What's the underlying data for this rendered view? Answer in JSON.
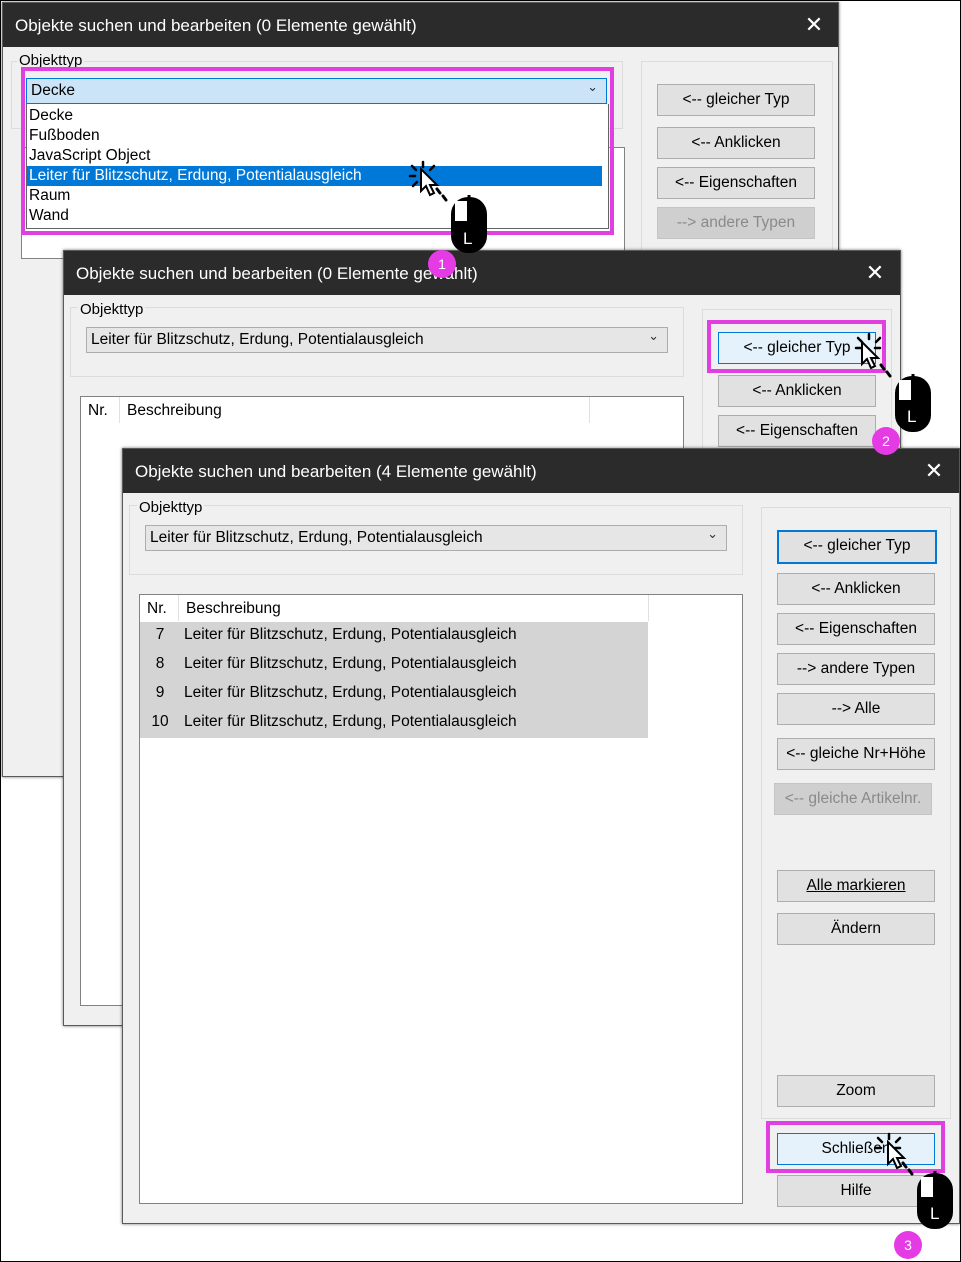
{
  "dialog1": {
    "title": "Objekte suchen und bearbeiten (0 Elemente gewählt)",
    "close": "✕",
    "group_label": "Objekttyp",
    "combo_value": "Decke",
    "dropdown_options": [
      "Decke",
      "Fußboden",
      "JavaScript Object",
      "Leiter für Blitzschutz, Erdung, Potentialausgleich",
      "Raum",
      "Wand"
    ],
    "selected_option_index": 3,
    "buttons": [
      "<-- gleicher Typ",
      "<-- Anklicken",
      "<-- Eigenschaften",
      "--> andere Typen"
    ],
    "marker": "1",
    "mouse_letter": "L"
  },
  "dialog2": {
    "title": "Objekte suchen und bearbeiten (0 Elemente gewählt)",
    "close": "✕",
    "group_label": "Objekttyp",
    "combo_value": "Leiter für Blitzschutz, Erdung, Potentialausgleich",
    "col_nr": "Nr.",
    "col_desc": "Beschreibung",
    "buttons": [
      "<-- gleicher Typ",
      "<-- Anklicken",
      "<-- Eigenschaften"
    ],
    "marker": "2",
    "mouse_letter": "L"
  },
  "dialog3": {
    "title": "Objekte suchen und bearbeiten (4 Elemente gewählt)",
    "close": "✕",
    "group_label": "Objekttyp",
    "combo_value": "Leiter für Blitzschutz, Erdung, Potentialausgleich",
    "col_nr": "Nr.",
    "col_desc": "Beschreibung",
    "rows": [
      {
        "nr": "7",
        "desc": "Leiter für Blitzschutz, Erdung, Potentialausgleich"
      },
      {
        "nr": "8",
        "desc": "Leiter für Blitzschutz, Erdung, Potentialausgleich"
      },
      {
        "nr": "9",
        "desc": "Leiter für Blitzschutz, Erdung, Potentialausgleich"
      },
      {
        "nr": "10",
        "desc": "Leiter für Blitzschutz, Erdung, Potentialausgleich"
      }
    ],
    "buttons": {
      "same_type": "<-- gleicher Typ",
      "click": "<-- Anklicken",
      "properties": "<-- Eigenschaften",
      "other_types": "--> andere Typen",
      "all": "--> Alle",
      "same_nr_height": "<-- gleiche Nr+Höhe",
      "same_article": "<-- gleiche Artikelnr.",
      "mark_all": "Alle markieren",
      "change": "Ändern",
      "zoom": "Zoom",
      "close": "Schließen",
      "help": "Hilfe"
    },
    "marker": "3",
    "mouse_letter": "L"
  },
  "colors": {
    "highlight": "#e040e0",
    "selection": "#0078d7",
    "titlebar": "#2b2b2b"
  }
}
